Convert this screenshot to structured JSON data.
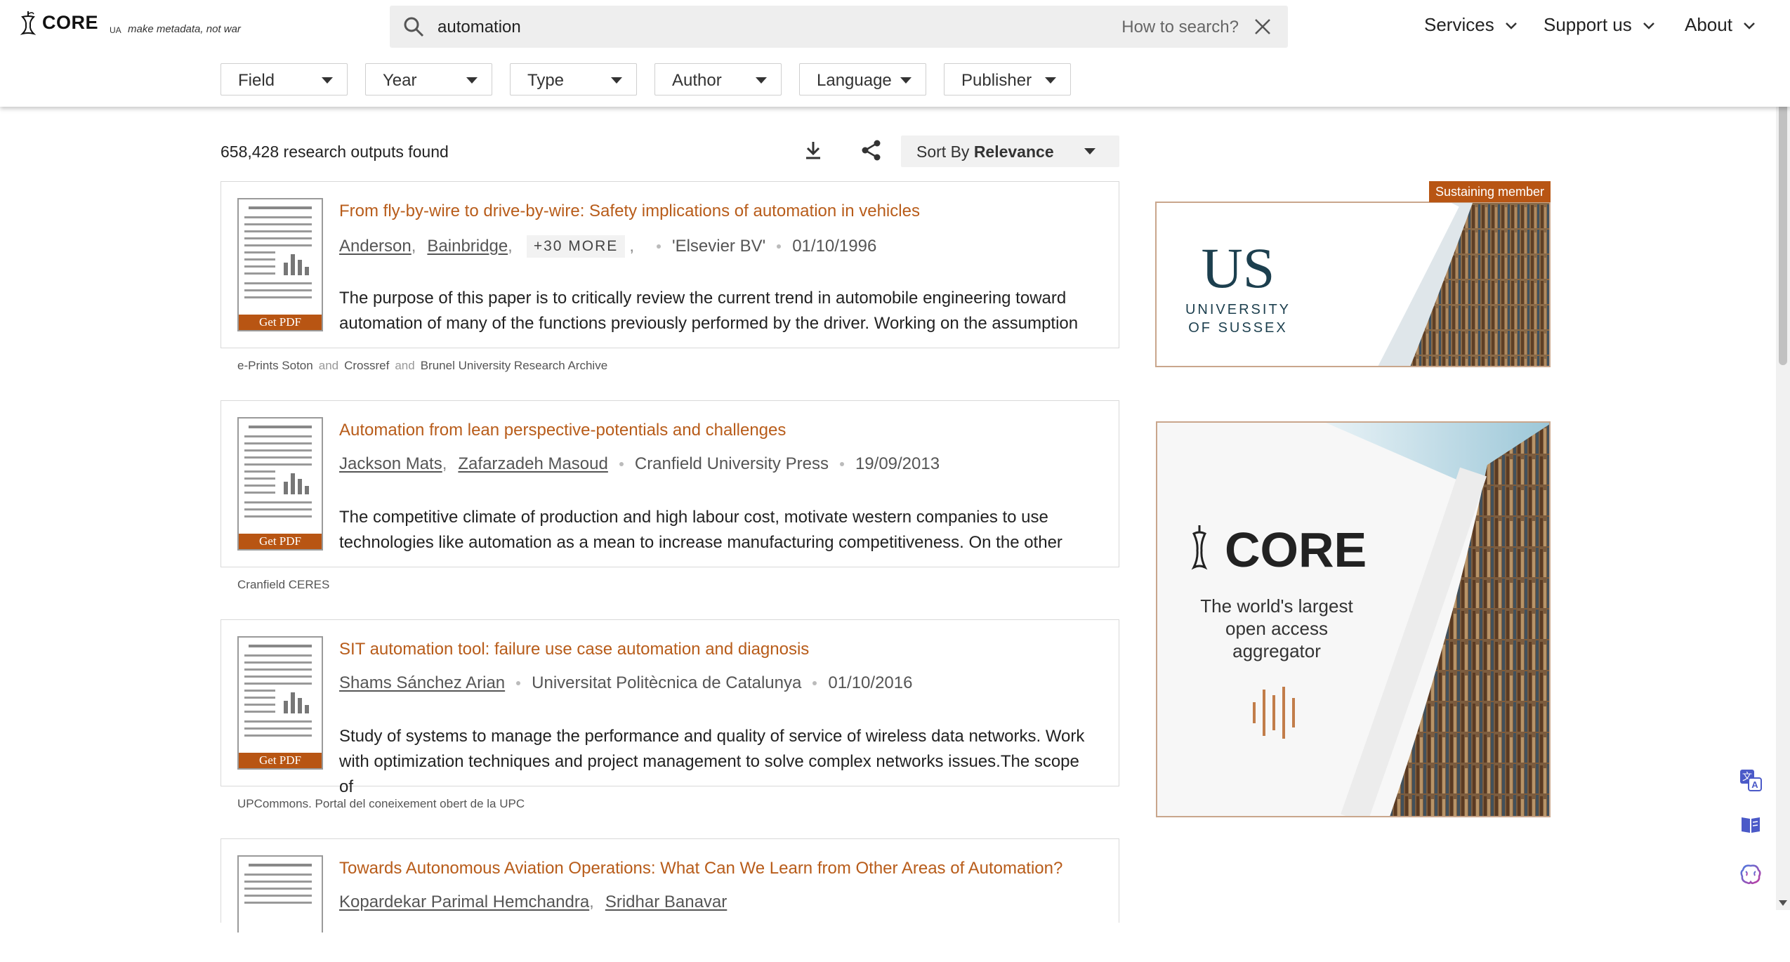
{
  "header": {
    "logo_text": "CORE",
    "ua": "UA",
    "tagline": "make metadata, not war",
    "search": {
      "value": "automation",
      "how_to": "How to search?"
    },
    "nav": [
      "Services",
      "Support us",
      "About"
    ]
  },
  "filters": [
    "Field",
    "Year",
    "Type",
    "Author",
    "Language",
    "Publisher"
  ],
  "results_bar": {
    "count": "658,428 research outputs found",
    "sort_label": "Sort By ",
    "sort_value": "Relevance"
  },
  "results": [
    {
      "title": "From fly-by-wire to drive-by-wire: Safety implications of automation in vehicles",
      "authors": [
        "Anderson",
        "Bainbridge"
      ],
      "more": "+30 MORE",
      "publisher": "'Elsevier BV'",
      "date": "01/10/1996",
      "abstract": "The purpose of this paper is to critically review the current trend in automobile engineering toward automation of many of the functions previously performed by the driver. Working on the assumption",
      "get_pdf": "Get PDF",
      "sources": [
        "e-Prints Soton",
        "Crossref",
        "Brunel University Research Archive"
      ]
    },
    {
      "title": "Automation from lean perspective-potentials and challenges",
      "authors": [
        "Jackson Mats",
        "Zafarzadeh Masoud"
      ],
      "publisher": "Cranfield University Press",
      "date": "19/09/2013",
      "abstract": "The competitive climate of production and high labour cost, motivate western companies to use technologies like automation as a mean to increase manufacturing competitiveness. On the other",
      "get_pdf": "Get PDF",
      "sources": [
        "Cranfield CERES"
      ]
    },
    {
      "title": "SIT automation tool: failure use case automation and diagnosis",
      "authors": [
        "Shams Sánchez Arian"
      ],
      "publisher": "Universitat Politècnica de Catalunya",
      "date": "01/10/2016",
      "abstract": "Study of systems to manage the performance and quality of service of wireless data networks. Work with optimization techniques and project management to solve complex networks issues.The scope of",
      "get_pdf": "Get PDF",
      "sources": [
        "UPCommons. Portal del coneixement obert de la UPC"
      ]
    },
    {
      "title": "Towards Autonomous Aviation Operations: What Can We Learn from Other Areas of Automation?",
      "authors": [
        "Kopardekar Parimal Hemchandra",
        "Sridhar Banavar"
      ]
    }
  ],
  "sources_and": "and",
  "ads": {
    "badge": "Sustaining member",
    "sussex_logo": "US",
    "sussex_line1": "UNIVERSITY",
    "sussex_line2": "OF SUSSEX",
    "core_logo": "CORE",
    "core_line1": "The world's largest",
    "core_line2": "open access",
    "core_line3": "aggregator"
  },
  "colors": {
    "accent": "#b85513",
    "title": "#b85c1a"
  },
  "icons": [
    "search-icon",
    "close-icon",
    "chevron-down-icon",
    "download-icon",
    "share-icon",
    "translate-icon",
    "reader-icon",
    "brain-icon"
  ]
}
